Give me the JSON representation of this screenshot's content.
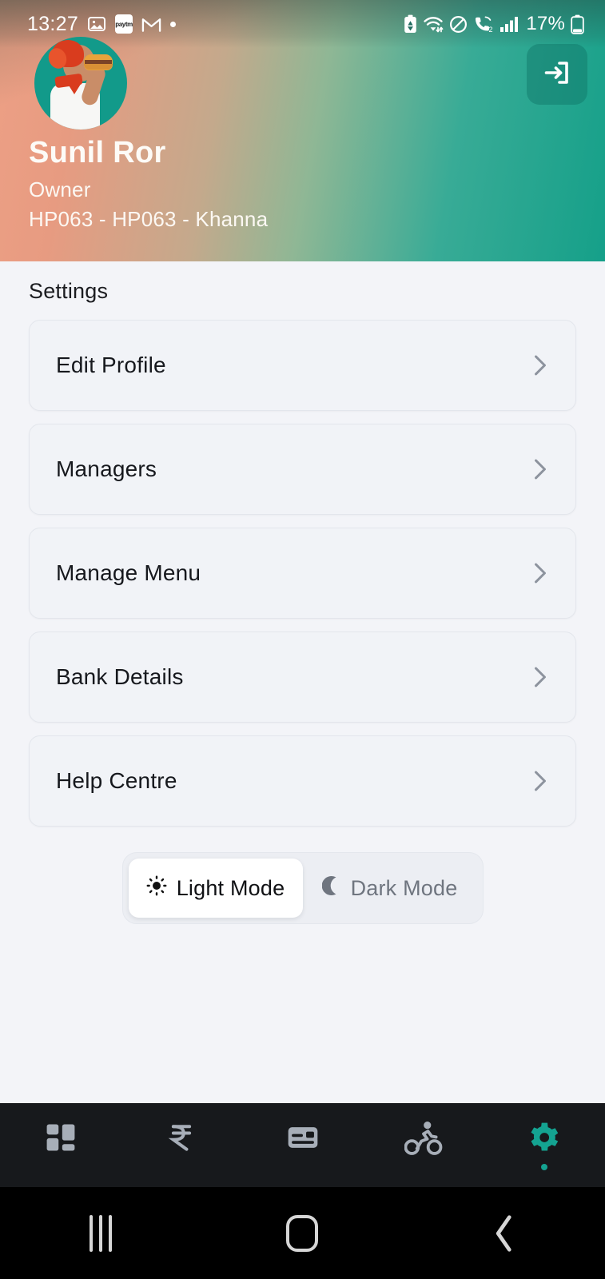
{
  "statusbar": {
    "time": "13:27",
    "left_icons": [
      "image-icon",
      "paytm-icon",
      "gmail-icon",
      "dot-icon"
    ],
    "paytm_label": "paytm",
    "right_icons": [
      "battery-saver-icon",
      "wifi-icon",
      "dnd-icon",
      "call-icon",
      "signal-icon"
    ],
    "battery_percent": "17%"
  },
  "header": {
    "avatar_alt": "burger-eating-mascot-avatar",
    "name": "Sunil Ror",
    "role": "Owner",
    "location": "HP063 - HP063 - Khanna",
    "logout_icon": "logout-icon",
    "gradient_start": "#eda085",
    "gradient_end": "#15a089"
  },
  "main": {
    "section_title": "Settings",
    "items": [
      {
        "label": "Edit Profile",
        "chevron": "chevron-right-icon"
      },
      {
        "label": "Managers",
        "chevron": "chevron-right-icon"
      },
      {
        "label": "Manage Menu",
        "chevron": "chevron-right-icon"
      },
      {
        "label": "Bank Details",
        "chevron": "chevron-right-icon"
      },
      {
        "label": "Help Centre",
        "chevron": "chevron-right-icon"
      }
    ]
  },
  "theme_toggle": {
    "options": [
      {
        "label": "Light Mode",
        "icon": "sun-icon",
        "selected": true
      },
      {
        "label": "Dark Mode",
        "icon": "moon-icon",
        "selected": false
      }
    ]
  },
  "bottom_nav": {
    "active_color": "#14a391",
    "inactive_color": "#a7aeb8",
    "items": [
      {
        "name": "dashboard",
        "icon": "dashboard-grid-icon",
        "active": false
      },
      {
        "name": "earnings",
        "icon": "rupee-icon",
        "active": false
      },
      {
        "name": "orders",
        "icon": "card-receipt-icon",
        "active": false
      },
      {
        "name": "delivery",
        "icon": "cyclist-icon",
        "active": false
      },
      {
        "name": "settings",
        "icon": "gear-icon",
        "active": true
      }
    ]
  },
  "android_nav": {
    "recents": "recents-icon",
    "home": "home-icon",
    "back": "back-icon"
  }
}
